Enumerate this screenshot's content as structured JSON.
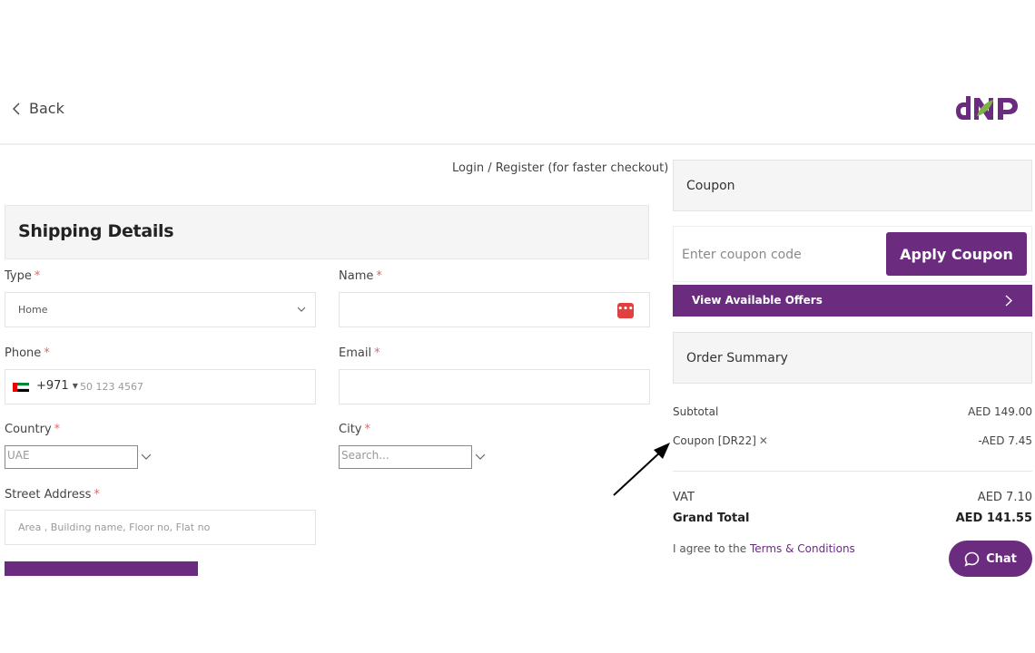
{
  "header": {
    "back_label": "Back",
    "brand_colors": {
      "purple": "#6b2c80",
      "green": "#7cb342"
    }
  },
  "login_link": "Login / Register (for faster checkout)",
  "shipping": {
    "title": "Shipping Details",
    "required_mark": "*",
    "type": {
      "label": "Type",
      "value": "Home"
    },
    "name": {
      "label": "Name",
      "value": ""
    },
    "phone": {
      "label": "Phone",
      "dial_code": "+971",
      "placeholder": "50 123 4567"
    },
    "email": {
      "label": "Email",
      "value": ""
    },
    "country": {
      "label": "Country",
      "value": "UAE"
    },
    "city": {
      "label": "City",
      "placeholder": "Search..."
    },
    "street": {
      "label": "Street Address",
      "placeholder": "Area , Building name, Floor no, Flat no"
    }
  },
  "coupon": {
    "title": "Coupon",
    "placeholder": "Enter coupon code",
    "apply_label": "Apply Coupon",
    "offers_label": "View Available Offers"
  },
  "summary": {
    "title": "Order Summary",
    "subtotal_label": "Subtotal",
    "subtotal_value": "AED 149.00",
    "coupon_label": "Coupon [DR22]",
    "coupon_value": "-AED 7.45",
    "vat_label": "VAT",
    "vat_value": "AED 7.10",
    "grand_label": "Grand Total",
    "grand_value": "AED 141.55"
  },
  "terms": {
    "prefix": "I agree to the",
    "link": "Terms & Conditions"
  },
  "chat": {
    "label": "Chat"
  },
  "icons": {
    "back": "chevron-left-icon",
    "select": "chevron-down-icon",
    "offers": "chevron-right-icon",
    "remove_coupon": "close-icon",
    "chat": "chat-bubble-icon",
    "flag": "uae-flag-icon"
  }
}
